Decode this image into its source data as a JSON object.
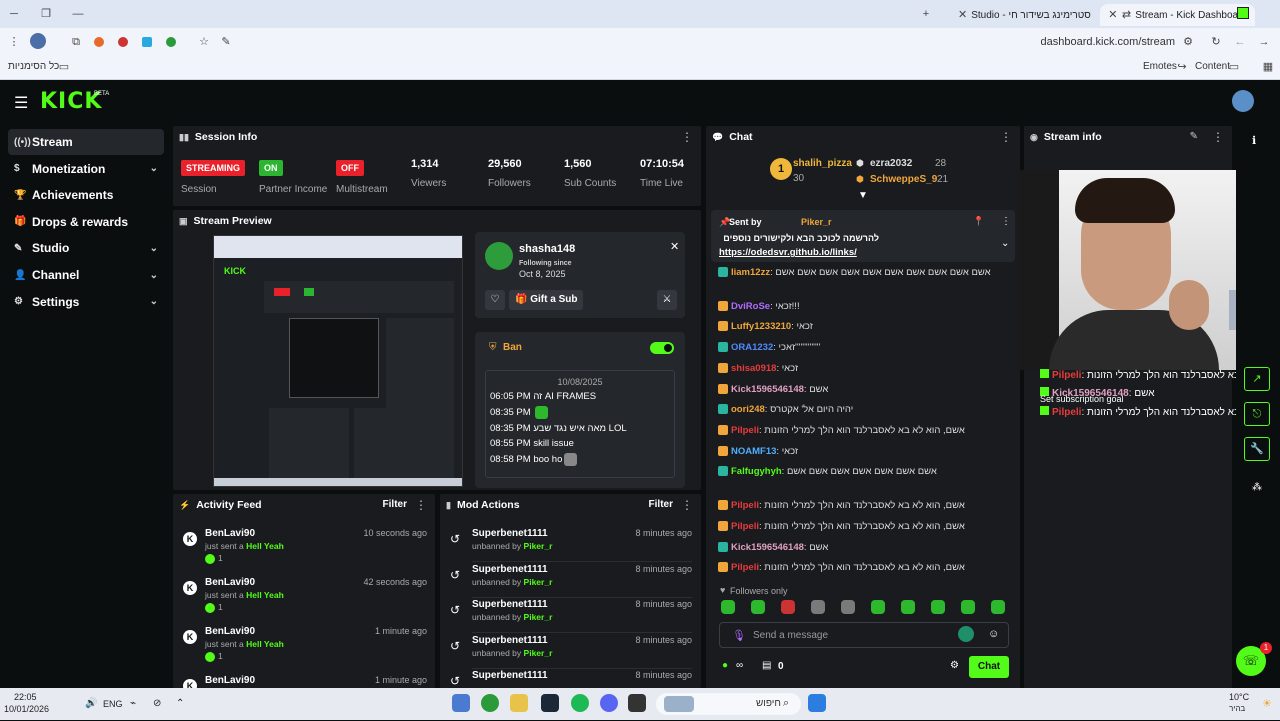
{
  "browser": {
    "tabs": [
      {
        "label": "Stream - Kick Dashboard",
        "active": true
      },
      {
        "label": "סטרימינג בשידור חי - Studio",
        "active": false
      }
    ],
    "url": "dashboard.kick.com/stream",
    "bookmarks_label": "כל הסימניות",
    "toolbar_right": [
      "Emotes",
      "Content"
    ]
  },
  "app": {
    "logo": "KICK",
    "logo_sup": "BETA",
    "sidebar": [
      {
        "label": "Stream",
        "icon": "stream-icon",
        "active": true,
        "chevron": false
      },
      {
        "label": "Monetization",
        "icon": "dollar-icon",
        "chevron": true
      },
      {
        "label": "Achievements",
        "icon": "trophy-icon",
        "chevron": false
      },
      {
        "label": "Drops & rewards",
        "icon": "gift-icon",
        "chevron": false
      },
      {
        "label": "Studio",
        "icon": "brush-icon",
        "chevron": true
      },
      {
        "label": "Channel",
        "icon": "person-icon",
        "chevron": true
      },
      {
        "label": "Settings",
        "icon": "gear-icon",
        "chevron": true
      }
    ]
  },
  "session": {
    "title": "Session Info",
    "items": [
      {
        "badge": "STREAMING",
        "badge_color": "#e8212b",
        "label": "Session"
      },
      {
        "badge": "ON",
        "badge_color": "#2bb531",
        "label": "Partner Income"
      },
      {
        "badge": "OFF",
        "badge_color": "#e8212b",
        "label": "Multistream"
      },
      {
        "value": "1,314",
        "label": "Viewers"
      },
      {
        "value": "29,560",
        "label": "Followers"
      },
      {
        "value": "1,560",
        "label": "Sub Counts"
      },
      {
        "value": "07:10:54",
        "label": "Time Live"
      }
    ]
  },
  "preview": {
    "title": "Stream Preview",
    "profile": {
      "name": "shasha148",
      "following_label": "Following since",
      "following_date": "Oct 8, 2025",
      "gift_label": "Gift a Sub",
      "ban_label": "Ban",
      "date": "10/08/2025",
      "messages": [
        {
          "time": "06:05 PM",
          "text": "זה AI FRAMES"
        },
        {
          "time": "08:35 PM",
          "text": ""
        },
        {
          "time": "08:35 PM",
          "text": "מאה איש נגד שבע LOL"
        },
        {
          "time": "08:55 PM",
          "text": "skill issue"
        },
        {
          "time": "08:58 PM",
          "text": "boo ho"
        }
      ]
    }
  },
  "activity": {
    "title": "Activity Feed",
    "filter": "Filter",
    "items": [
      {
        "name": "BenLavi90",
        "sub": "just sent a",
        "item": "Hell Yeah",
        "count": "1",
        "time": "10 seconds ago"
      },
      {
        "name": "BenLavi90",
        "sub": "just sent a",
        "item": "Hell Yeah",
        "count": "1",
        "time": "42 seconds ago"
      },
      {
        "name": "BenLavi90",
        "sub": "just sent a",
        "item": "Hell Yeah",
        "count": "1",
        "time": "1 minute ago"
      },
      {
        "name": "BenLavi90",
        "sub": "",
        "item": "",
        "count": "",
        "time": "1 minute ago"
      }
    ]
  },
  "mod": {
    "title": "Mod Actions",
    "filter": "Filter",
    "items": [
      {
        "name": "Superbenet1111",
        "sub": "unbanned by",
        "by": "Piker_r",
        "time": "8 minutes ago"
      },
      {
        "name": "Superbenet1111",
        "sub": "unbanned by",
        "by": "Piker_r",
        "time": "8 minutes ago"
      },
      {
        "name": "Superbenet1111",
        "sub": "unbanned by",
        "by": "Piker_r",
        "time": "8 minutes ago"
      },
      {
        "name": "Superbenet1111",
        "sub": "unbanned by",
        "by": "Piker_r",
        "time": "8 minutes ago"
      },
      {
        "name": "Superbenet1111",
        "sub": "",
        "by": "",
        "time": "8 minutes ago"
      }
    ]
  },
  "chat": {
    "title": "Chat",
    "leaders": [
      {
        "rank": "1",
        "name": "shalih_pizza",
        "count": "30"
      },
      {
        "rank": "",
        "name": "ezra2032",
        "count": "28"
      },
      {
        "rank": "",
        "name": "SchweppeS_9",
        "count": "21"
      }
    ],
    "pinned": {
      "sent_by_label": "Sent by",
      "user": "Piker_r",
      "text": "להרשמה לכוכב הבא ולקישורים נוספים",
      "link": "https://odedsvr.github.io/links/"
    },
    "messages": [
      {
        "user": "liam12zz",
        "color": "#f0a63a",
        "text": "אשם אשם אשם אשם אשם אשם אשם אשם אשם אשם"
      },
      {
        "user": "DviRoSe",
        "color": "#b06bff",
        "text": "זכאי!!!"
      },
      {
        "user": "Luffy1233210",
        "color": "#f0a63a",
        "text": "זכאי"
      },
      {
        "user": "ORA1232",
        "color": "#4f8bff",
        "text": "זאכי''''''''''''''"
      },
      {
        "user": "shisa0918",
        "color": "#e83c3c",
        "text": "זכאי"
      },
      {
        "user": "Kick1596546148",
        "color": "#e0a0c0",
        "text": "אשם"
      },
      {
        "user": "oori248",
        "color": "#f0a63a",
        "text": "יהיה היום אל' אקטרס"
      },
      {
        "user": "Pilpeli",
        "color": "#e83c3c",
        "text": "אשם, הוא לא בא לאסברלנד הוא הלך למרלי הזונות"
      },
      {
        "user": "NOAMF13",
        "color": "#4fb0ff",
        "text": "זכאי"
      },
      {
        "user": "Falfugyhyh",
        "color": "#53fc18",
        "text": "אשם אשם אשם אשם אשם אשם אשם"
      },
      {
        "user": "Pilpeli",
        "color": "#e83c3c",
        "text": "אשם, הוא לא בא לאסברלנד הוא הלך למרלי הזונות"
      },
      {
        "user": "Pilpeli",
        "color": "#e83c3c",
        "text": "אשם, הוא לא בא לאסברלנד הוא הלך למרלי הזונות"
      },
      {
        "user": "Kick1596546148",
        "color": "#e0a0c0",
        "text": "אשם"
      },
      {
        "user": "Pilpeli",
        "color": "#e83c3c",
        "text": "אשם, הוא לא בא לאסברלנד הוא הלך למרלי הזונות"
      }
    ],
    "followers_only": "Followers only",
    "placeholder": "Send a message",
    "send_label": "Chat",
    "points": "0"
  },
  "stream_info": {
    "title": "Stream info",
    "overlay_lines": [
      {
        "user": "Pilpeli",
        "text": "אשם, הוא לא בא לאסברלנד הוא הלך למרלי הזונות"
      },
      {
        "user": "Kick1596546148",
        "text": "אשם"
      },
      {
        "user": "Pilpeli",
        "text": "אשם, הוא לא בא לאסברלנד הוא הלך למרלי הזונות"
      }
    ],
    "goal_label": "Set subscription goal",
    "support_badge": "1"
  },
  "taskbar": {
    "time": "22:05",
    "date": "10/01/2026",
    "lang": "ENG",
    "search": "חיפוש",
    "weather": "10°C",
    "weather_sub": "בהיר"
  }
}
